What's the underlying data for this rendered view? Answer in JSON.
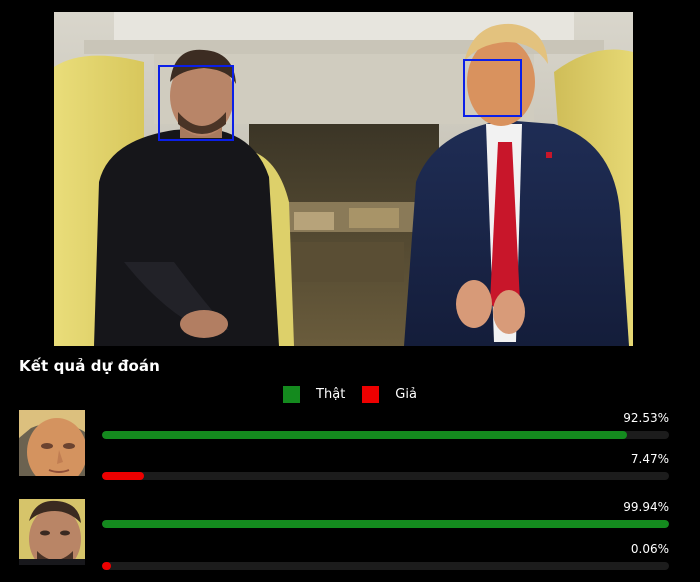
{
  "results": {
    "title": "Kết quả dự đoán",
    "legend": [
      {
        "label": "Thật",
        "color": "#148a1e"
      },
      {
        "label": "Giả",
        "color": "#ee0000"
      }
    ],
    "rows": [
      {
        "subject": "older man with light hair",
        "real": {
          "label": "92.53%",
          "value": 92.53
        },
        "fake": {
          "label": "7.47%",
          "value": 7.47
        }
      },
      {
        "subject": "man with dark hair",
        "real": {
          "label": "99.94%",
          "value": 99.94
        },
        "fake": {
          "label": "0.06%",
          "value": 0.06
        }
      }
    ]
  },
  "colors": {
    "real": "#148a1e",
    "fake": "#ee0000",
    "face_box": "#0b1fe8"
  }
}
